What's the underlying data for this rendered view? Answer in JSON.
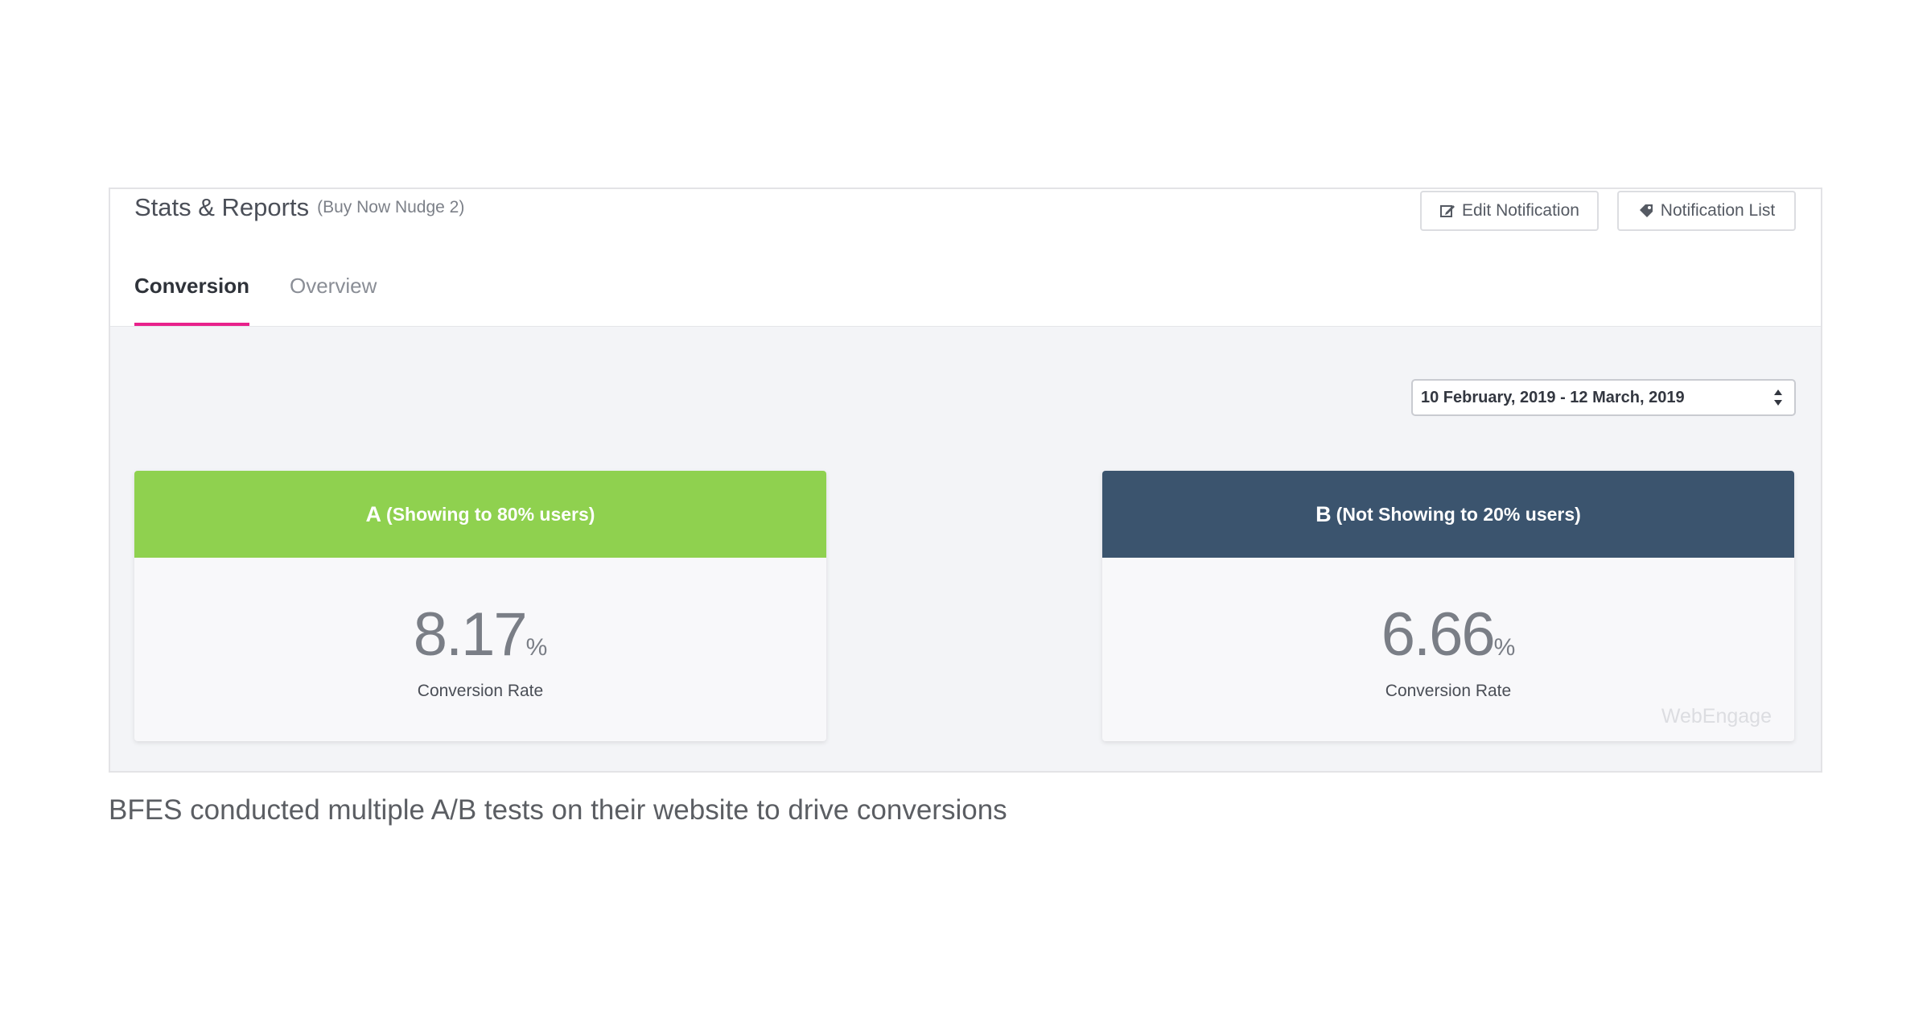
{
  "header": {
    "title": "Stats & Reports",
    "subtitle": "(Buy Now Nudge 2)",
    "edit_button": {
      "label": "Edit Notification",
      "icon": "edit-icon"
    },
    "list_button": {
      "label": "Notification List",
      "icon": "tag-icon"
    }
  },
  "tabs": [
    {
      "label": "Conversion",
      "active": true
    },
    {
      "label": "Overview",
      "active": false
    }
  ],
  "date_range": {
    "value": "10 February, 2019 - 12 March, 2019",
    "icon": "sort-arrows-icon"
  },
  "variants": [
    {
      "letter": "A",
      "description": "(Showing to 80% users)",
      "rate": "8.17",
      "unit": "%",
      "label": "Conversion Rate",
      "color": "#8fd14f"
    },
    {
      "letter": "B",
      "description": "(Not Showing to 20% users)",
      "rate": "6.66",
      "unit": "%",
      "label": "Conversion Rate",
      "color": "#3b546e"
    }
  ],
  "watermark": "WebEngage",
  "accent_color": "#e8218b",
  "caption": "BFES conducted multiple A/B tests on their website to drive conversions"
}
